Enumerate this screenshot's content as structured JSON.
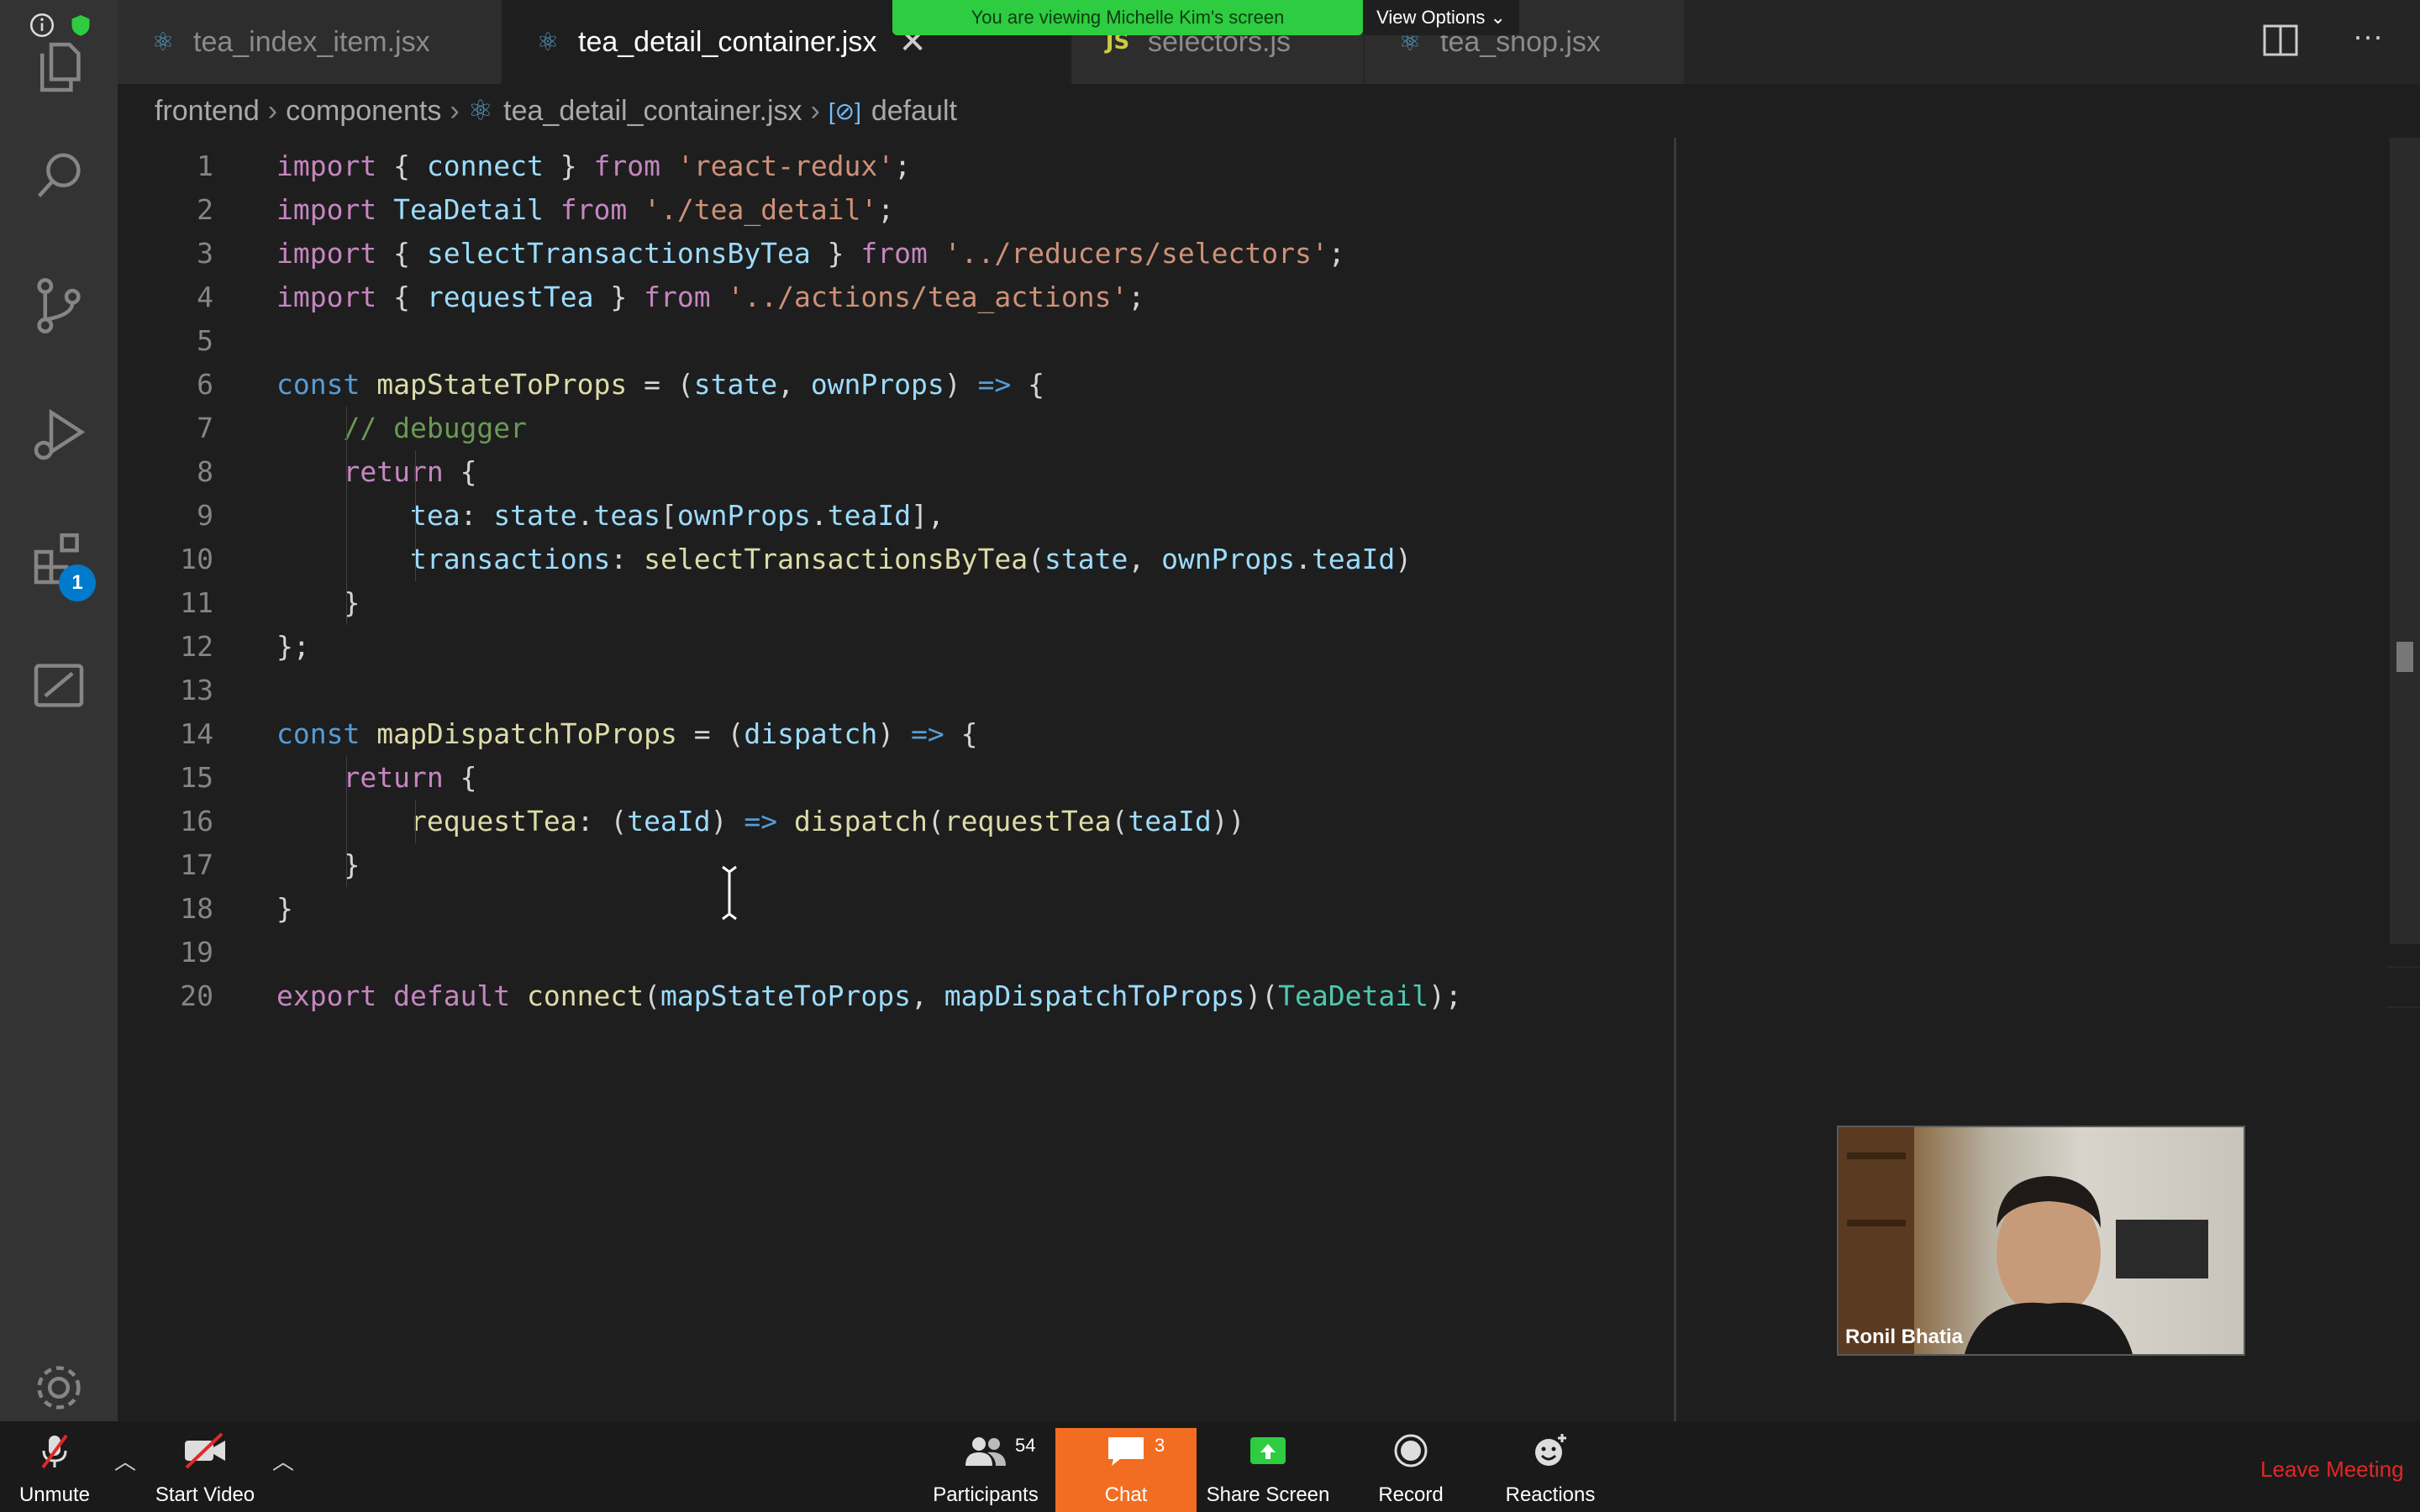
{
  "zoom": {
    "banner": "You are viewing Michelle Kim's screen",
    "view_options": "View Options ⌄",
    "participant_name": "Ronil Bhatia",
    "toolbar": {
      "unmute": "Unmute",
      "start_video": "Start Video",
      "participants": "Participants",
      "participants_count": "54",
      "chat": "Chat",
      "chat_count": "3",
      "share_screen": "Share Screen",
      "record": "Record",
      "reactions": "Reactions",
      "leave": "Leave Meeting"
    }
  },
  "activity_bar": {
    "extensions_badge": "1"
  },
  "tabs": [
    {
      "label": "tea_index_item.jsx",
      "icon": "react-icon"
    },
    {
      "label": "tea_detail_container.jsx",
      "icon": "react-icon",
      "active": true,
      "close": "✕"
    },
    {
      "label": "selectors.js",
      "icon": "js-icon",
      "icon_text": "JS"
    },
    {
      "label": "tea_shop.jsx",
      "icon": "react-icon"
    }
  ],
  "breadcrumb": {
    "items": [
      "frontend",
      "components",
      "tea_detail_container.jsx",
      "default"
    ],
    "separator": "›"
  },
  "editor": {
    "line_numbers": [
      "1",
      "2",
      "3",
      "4",
      "5",
      "6",
      "7",
      "8",
      "9",
      "10",
      "11",
      "12",
      "13",
      "14",
      "15",
      "16",
      "17",
      "18",
      "19",
      "20"
    ],
    "lines": [
      [
        [
          "ctl",
          "import"
        ],
        [
          "pl",
          " { "
        ],
        [
          "var",
          "connect"
        ],
        [
          "pl",
          " } "
        ],
        [
          "ctl",
          "from"
        ],
        [
          "pl",
          " "
        ],
        [
          "str",
          "'react-redux'"
        ],
        [
          "pl",
          ";"
        ]
      ],
      [
        [
          "ctl",
          "import"
        ],
        [
          "pl",
          " "
        ],
        [
          "var",
          "TeaDetail"
        ],
        [
          "pl",
          " "
        ],
        [
          "ctl",
          "from"
        ],
        [
          "pl",
          " "
        ],
        [
          "str",
          "'./tea_detail'"
        ],
        [
          "pl",
          ";"
        ]
      ],
      [
        [
          "ctl",
          "import"
        ],
        [
          "pl",
          " { "
        ],
        [
          "var",
          "selectTransactionsByTea"
        ],
        [
          "pl",
          " } "
        ],
        [
          "ctl",
          "from"
        ],
        [
          "pl",
          " "
        ],
        [
          "str",
          "'../reducers/selectors'"
        ],
        [
          "pl",
          ";"
        ]
      ],
      [
        [
          "ctl",
          "import"
        ],
        [
          "pl",
          " { "
        ],
        [
          "var",
          "requestTea"
        ],
        [
          "pl",
          " } "
        ],
        [
          "ctl",
          "from"
        ],
        [
          "pl",
          " "
        ],
        [
          "str",
          "'../actions/tea_actions'"
        ],
        [
          "pl",
          ";"
        ]
      ],
      [],
      [
        [
          "kw",
          "const"
        ],
        [
          "pl",
          " "
        ],
        [
          "fn",
          "mapStateToProps"
        ],
        [
          "pl",
          " = ("
        ],
        [
          "var",
          "state"
        ],
        [
          "pl",
          ", "
        ],
        [
          "var",
          "ownProps"
        ],
        [
          "pl",
          ") "
        ],
        [
          "kw",
          "=>"
        ],
        [
          "pl",
          " {"
        ]
      ],
      [
        [
          "pl",
          "    "
        ],
        [
          "cm",
          "// debugger"
        ]
      ],
      [
        [
          "pl",
          "    "
        ],
        [
          "ctl",
          "return"
        ],
        [
          "pl",
          " {"
        ]
      ],
      [
        [
          "pl",
          "        "
        ],
        [
          "var",
          "tea"
        ],
        [
          "pl",
          ": "
        ],
        [
          "var",
          "state"
        ],
        [
          "pl",
          "."
        ],
        [
          "var",
          "teas"
        ],
        [
          "pl",
          "["
        ],
        [
          "var",
          "ownProps"
        ],
        [
          "pl",
          "."
        ],
        [
          "var",
          "teaId"
        ],
        [
          "pl",
          "],"
        ]
      ],
      [
        [
          "pl",
          "        "
        ],
        [
          "var",
          "transactions"
        ],
        [
          "pl",
          ": "
        ],
        [
          "fn",
          "selectTransactionsByTea"
        ],
        [
          "pl",
          "("
        ],
        [
          "var",
          "state"
        ],
        [
          "pl",
          ", "
        ],
        [
          "var",
          "ownProps"
        ],
        [
          "pl",
          "."
        ],
        [
          "var",
          "teaId"
        ],
        [
          "pl",
          ")"
        ]
      ],
      [
        [
          "pl",
          "    }"
        ]
      ],
      [
        [
          "pl",
          "};"
        ]
      ],
      [],
      [
        [
          "kw",
          "const"
        ],
        [
          "pl",
          " "
        ],
        [
          "fn",
          "mapDispatchToProps"
        ],
        [
          "pl",
          " = ("
        ],
        [
          "var",
          "dispatch"
        ],
        [
          "pl",
          ") "
        ],
        [
          "kw",
          "=>"
        ],
        [
          "pl",
          " {"
        ]
      ],
      [
        [
          "pl",
          "    "
        ],
        [
          "ctl",
          "return"
        ],
        [
          "pl",
          " {"
        ]
      ],
      [
        [
          "pl",
          "        "
        ],
        [
          "fn",
          "requestTea"
        ],
        [
          "pl",
          ": ("
        ],
        [
          "var",
          "teaId"
        ],
        [
          "pl",
          ") "
        ],
        [
          "kw",
          "=>"
        ],
        [
          "pl",
          " "
        ],
        [
          "fn",
          "dispatch"
        ],
        [
          "pl",
          "("
        ],
        [
          "fn",
          "requestTea"
        ],
        [
          "pl",
          "("
        ],
        [
          "var",
          "teaId"
        ],
        [
          "pl",
          "))"
        ]
      ],
      [
        [
          "pl",
          "    }"
        ]
      ],
      [
        [
          "pl",
          "}"
        ]
      ],
      [],
      [
        [
          "ctl",
          "export"
        ],
        [
          "pl",
          " "
        ],
        [
          "ctl",
          "default"
        ],
        [
          "pl",
          " "
        ],
        [
          "fn",
          "connect"
        ],
        [
          "pl",
          "("
        ],
        [
          "var",
          "mapStateToProps"
        ],
        [
          "pl",
          ", "
        ],
        [
          "var",
          "mapDispatchToProps"
        ],
        [
          "pl",
          ")("
        ],
        [
          "cls",
          "TeaDetail"
        ],
        [
          "pl",
          ");"
        ]
      ]
    ]
  },
  "colors": {
    "accent": "#007acc",
    "chat": "#f26d21",
    "banner": "#2ecc40",
    "leave": "#e02828"
  }
}
